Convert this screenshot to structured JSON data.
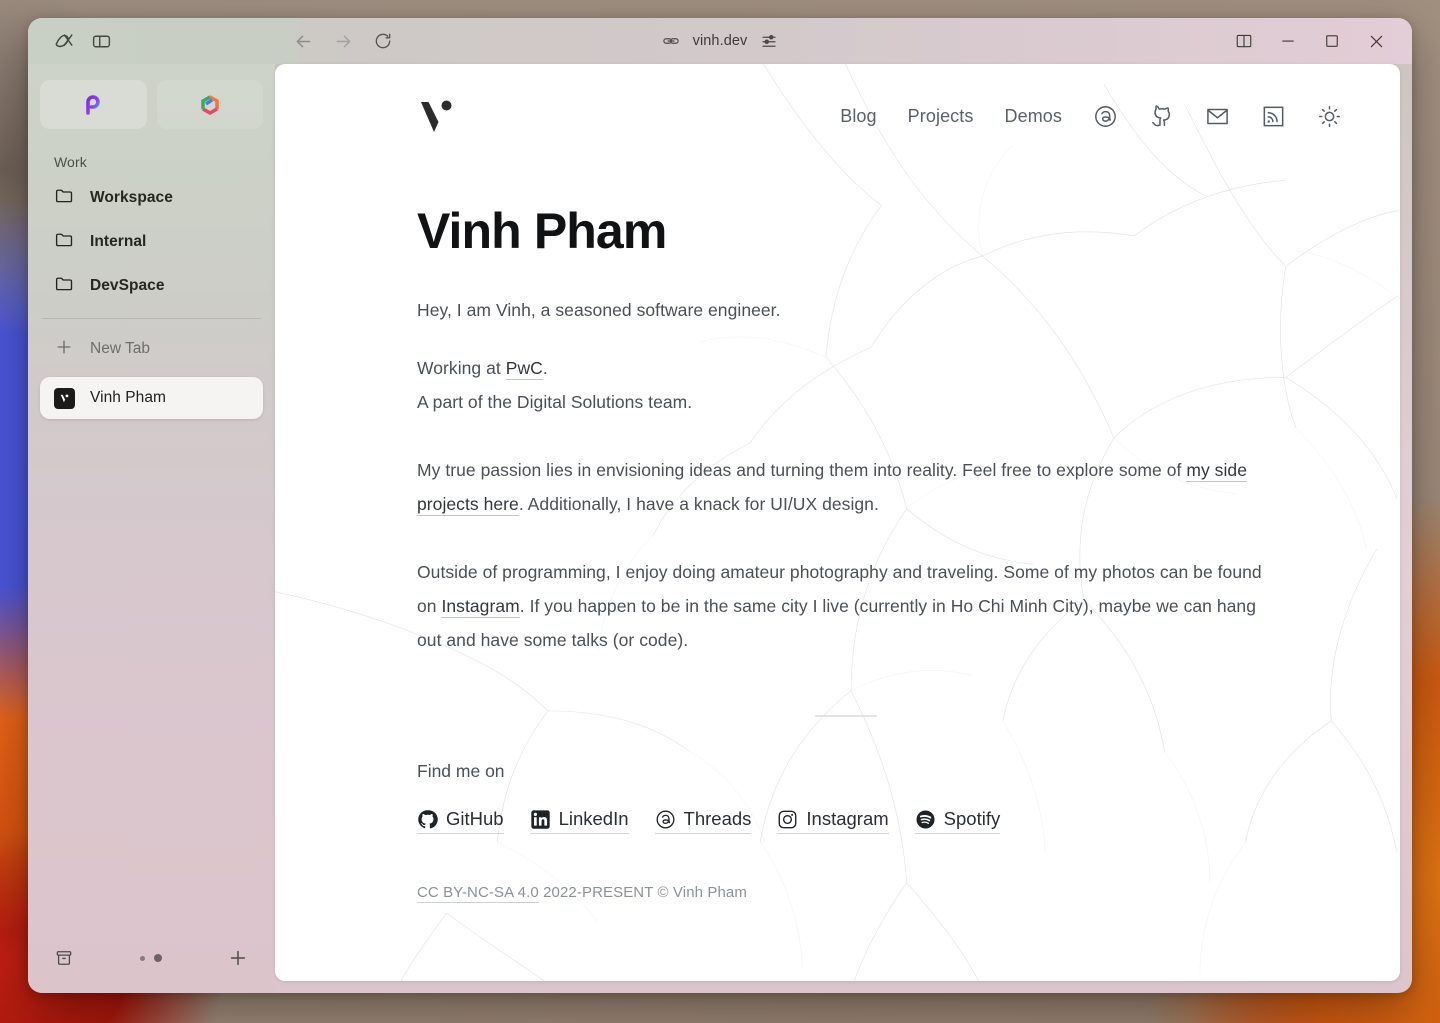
{
  "titlebar": {
    "arc_icon": "arc-logo-icon",
    "sidebar_toggle_icon": "sidebar-toggle-icon",
    "back_icon": "back-arrow-icon",
    "forward_icon": "forward-arrow-icon",
    "reload_icon": "reload-icon",
    "link_icon": "link-icon",
    "url": "vinh.dev",
    "tune_icon": "sliders-icon",
    "split_view_icon": "split-view-icon",
    "minimize_icon": "minimize-icon",
    "maximize_icon": "maximize-icon",
    "close_icon": "close-icon"
  },
  "sidebar": {
    "spaces": [
      {
        "name": "space-1",
        "state": "active"
      },
      {
        "name": "space-2",
        "state": "inactive"
      }
    ],
    "section_title": "Work",
    "folders": [
      {
        "label": "Workspace",
        "icon": "folder-icon"
      },
      {
        "label": "Internal",
        "icon": "folder-icon"
      },
      {
        "label": "DevSpace",
        "icon": "folder-icon"
      }
    ],
    "new_tab": {
      "label": "New Tab",
      "icon": "plus-icon"
    },
    "tabs": [
      {
        "label": "Vinh Pham",
        "favicon": "vinh-favicon",
        "active": true
      }
    ],
    "bottom": {
      "archive_icon": "archive-icon",
      "page_dots": 2,
      "add_icon": "plus-icon"
    }
  },
  "site": {
    "logo_alt": "vinh-logo",
    "nav": [
      {
        "label": "Blog",
        "type": "text"
      },
      {
        "label": "Projects",
        "type": "text"
      },
      {
        "label": "Demos",
        "type": "text"
      }
    ],
    "nav_icons": [
      {
        "name": "threads-icon"
      },
      {
        "name": "github-icon"
      },
      {
        "name": "mail-icon"
      },
      {
        "name": "rss-icon"
      },
      {
        "name": "theme-toggle-sun-icon"
      }
    ],
    "title": "Vinh Pham",
    "paragraphs": {
      "intro": "Hey, I am Vinh, a seasoned software engineer.",
      "working_prefix": "Working at ",
      "working_link": "PwC",
      "working_suffix": ".",
      "team": "A part of the Digital Solutions team.",
      "passion_prefix": "My true passion lies in envisioning ideas and turning them into reality. Feel free to explore some of ",
      "passion_link": "my side projects here",
      "passion_suffix": ". Additionally, I have a knack for UI/UX design.",
      "outside_prefix": "Outside of programming, I enjoy doing amateur photography and traveling. Some of my photos can be found on ",
      "outside_link": "Instagram",
      "outside_suffix": ". If you happen to be in the same city I live (currently in Ho Chi Minh City), maybe we can hang out and have some talks (or code)."
    },
    "find_me_on": "Find me on",
    "socials": [
      {
        "label": "GitHub",
        "icon": "github-icon"
      },
      {
        "label": "LinkedIn",
        "icon": "linkedin-icon"
      },
      {
        "label": "Threads",
        "icon": "threads-icon"
      },
      {
        "label": "Instagram",
        "icon": "instagram-icon"
      },
      {
        "label": "Spotify",
        "icon": "spotify-icon"
      }
    ],
    "footer": {
      "license": "CC BY-NC-SA 4.0",
      "rest": " 2022-PRESENT © Vinh Pham"
    }
  },
  "colors": {
    "window_chrome": "#d3c9cb",
    "sidebar_top": "#cdd3c8",
    "sidebar_bottom": "#dcc4cb",
    "page_bg": "#ffffff",
    "heading": "#111214",
    "body_text": "#4b5057",
    "nav_text": "#5b6168",
    "footer_text": "#8c9197"
  }
}
